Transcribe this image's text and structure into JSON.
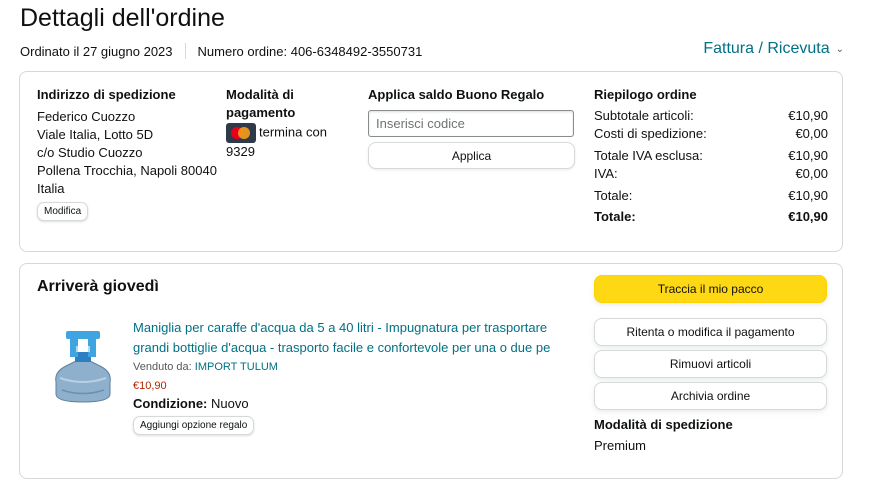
{
  "page": {
    "title": "Dettagli dell'ordine",
    "ordered_date": "Ordinato il 27 giugno 2023",
    "order_number": "Numero ordine: 406-6348492-3550731",
    "invoice_link": "Fattura / Ricevuta"
  },
  "shipping_address": {
    "heading": "Indirizzo di spedizione",
    "lines": [
      "Federico Cuozzo",
      "Viale Italia, Lotto 5D",
      "c/o Studio Cuozzo",
      "Pollena Trocchia, Napoli 80040",
      "Italia"
    ],
    "edit_button": "Modifica"
  },
  "payment": {
    "heading_line1": "Modalità di",
    "heading_line2": "pagamento",
    "card_text": "termina con",
    "card_last4": "9329",
    "card_icon": "mastercard-icon"
  },
  "gift_card": {
    "heading": "Applica saldo Buono Regalo",
    "placeholder": "Inserisci codice",
    "apply_button": "Applica"
  },
  "summary": {
    "heading": "Riepilogo ordine",
    "rows": [
      {
        "label": "Subtotale articoli:",
        "value": "€10,90"
      },
      {
        "label": "Costi di spedizione:",
        "value": "€0,00"
      },
      {
        "label": "Totale IVA esclusa:",
        "value": "€10,90"
      },
      {
        "label": "IVA:",
        "value": "€0,00"
      },
      {
        "label": "Totale:",
        "value": "€10,90"
      }
    ],
    "grand_total_label": "Totale:",
    "grand_total_value": "€10,90"
  },
  "shipment": {
    "arrival": "Arriverà giovedì",
    "product_title": "Maniglia per caraffe d'acqua da 5 a 40 litri - Impugnatura per trasportare grandi bottiglie d'acqua - trasporto facile e confortevole per una o due pe",
    "sold_by_label": "Venduto da:",
    "seller": "IMPORT TULUM",
    "price": "€10,90",
    "condition_label": "Condizione:",
    "condition_value": "Nuovo",
    "gift_button": "Aggiungi opzione regalo",
    "actions": {
      "track": "Traccia il mio pacco",
      "retry_payment": "Ritenta o modifica il pagamento",
      "remove": "Rimuovi articoli",
      "archive": "Archivia ordine"
    },
    "shipping_method_heading": "Modalità di spedizione",
    "shipping_method": "Premium"
  },
  "colors": {
    "link": "#007185",
    "price": "#b12704",
    "primary_button": "#ffd814",
    "border": "#d5d9d9"
  }
}
